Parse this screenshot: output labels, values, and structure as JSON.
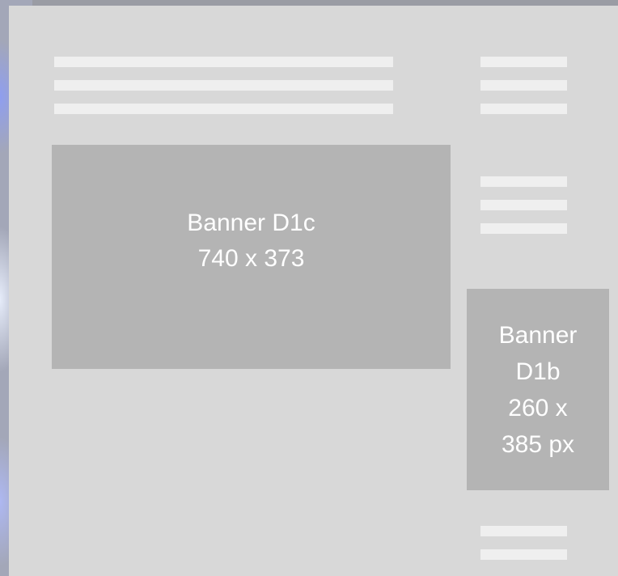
{
  "banner_main": {
    "line1": "Banner D1c",
    "line2": "740 x 373"
  },
  "banner_side": {
    "line1": "Banner",
    "line2": "D1b",
    "line3": "260 x",
    "line4": "385 px"
  },
  "colors": {
    "page": "#d8d8d8",
    "placeholder_line": "#efefef",
    "banner": "#b4b4b4",
    "banner_text": "#ffffff"
  }
}
